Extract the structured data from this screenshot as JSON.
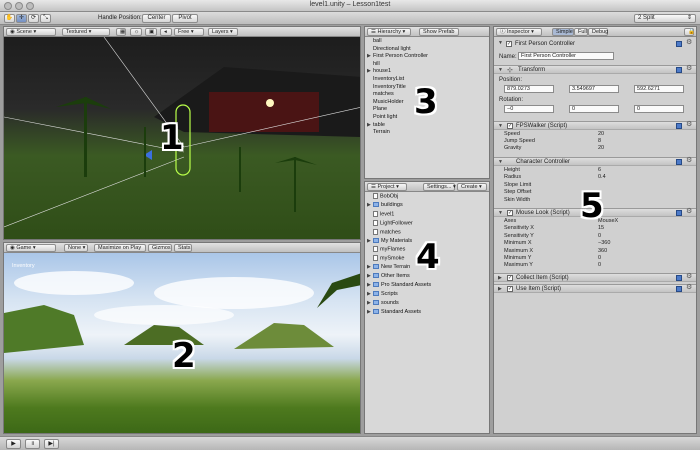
{
  "window": {
    "title": "level1.unity – Lesson1test"
  },
  "toolbar": {
    "handle_position_label": "Handle Position:",
    "center_label": "Center",
    "pivot_label": "Pivot",
    "layout_dropdown": "2 Split"
  },
  "scene": {
    "tab": "Scene",
    "render_mode": "Textured",
    "rgb_label": "RGB",
    "camera_mode": "Free",
    "layers_label": "Layers"
  },
  "game": {
    "tab": "Game",
    "aspect": "None",
    "maximize_on_play": "Maximize on Play",
    "gizmos": "Gizmos",
    "stats": "Stats",
    "overlay_text": "Inventory"
  },
  "hierarchy": {
    "tab": "Hierarchy",
    "show_prefab": "Show Prefab",
    "items": [
      {
        "label": "ball",
        "arrow": ""
      },
      {
        "label": "Directional light",
        "arrow": ""
      },
      {
        "label": "First Person Controller",
        "arrow": "▶"
      },
      {
        "label": "hill",
        "arrow": ""
      },
      {
        "label": "house1",
        "arrow": "▶"
      },
      {
        "label": "InventoryList",
        "arrow": ""
      },
      {
        "label": "InventoryTitle",
        "arrow": ""
      },
      {
        "label": "matches",
        "arrow": ""
      },
      {
        "label": "MusicHolder",
        "arrow": ""
      },
      {
        "label": "Plane",
        "arrow": ""
      },
      {
        "label": "Point light",
        "arrow": ""
      },
      {
        "label": "table",
        "arrow": "▶"
      },
      {
        "label": "Terrain",
        "arrow": ""
      }
    ]
  },
  "project": {
    "tab": "Project",
    "settings": "Settings...",
    "create": "Create",
    "items": [
      {
        "label": "BobObj",
        "arrow": "",
        "kind": "file"
      },
      {
        "label": "buildings",
        "arrow": "▶",
        "kind": "folder"
      },
      {
        "label": "level1",
        "arrow": "",
        "kind": "file"
      },
      {
        "label": "LightFollower",
        "arrow": "",
        "kind": "file"
      },
      {
        "label": "matches",
        "arrow": "",
        "kind": "file"
      },
      {
        "label": "My Materials",
        "arrow": "▶",
        "kind": "folder"
      },
      {
        "label": "myFlames",
        "arrow": "",
        "kind": "file"
      },
      {
        "label": "mySmoke",
        "arrow": "",
        "kind": "file"
      },
      {
        "label": "New Terrain",
        "arrow": "▶",
        "kind": "folder"
      },
      {
        "label": "Other Items",
        "arrow": "▶",
        "kind": "folder"
      },
      {
        "label": "Pro Standard Assets",
        "arrow": "▶",
        "kind": "folder"
      },
      {
        "label": "Scripts",
        "arrow": "▶",
        "kind": "folder"
      },
      {
        "label": "sounds",
        "arrow": "▶",
        "kind": "folder"
      },
      {
        "label": "Standard Assets",
        "arrow": "▶",
        "kind": "folder"
      }
    ]
  },
  "inspector": {
    "tab": "Inspector",
    "modes": [
      "Simple",
      "Full",
      "Debug"
    ],
    "object_name_header": "First Person Controller",
    "name_label": "Name:",
    "name_value": "First Person Controller",
    "transform": {
      "title": "Transform",
      "position_label": "Position:",
      "position": [
        "879.0273",
        "3.549697",
        "592.6271"
      ],
      "rotation_label": "Rotation:",
      "rotation": [
        "−0",
        "0",
        "0"
      ]
    },
    "fpswalker": {
      "title": "FPSWalker (Script)",
      "props": [
        {
          "name": "Speed",
          "value": "20"
        },
        {
          "name": "Jump Speed",
          "value": "8"
        },
        {
          "name": "Gravity",
          "value": "20"
        }
      ]
    },
    "character_controller": {
      "title": "Character Controller",
      "props": [
        {
          "name": "Height",
          "value": "6"
        },
        {
          "name": "Radius",
          "value": "0.4"
        },
        {
          "name": "Slope Limit",
          "value": ""
        },
        {
          "name": "Step Offset",
          "value": ""
        },
        {
          "name": "Skin Width",
          "value": ""
        }
      ]
    },
    "mouse_look": {
      "title": "Mouse Look (Script)",
      "props": [
        {
          "name": "Axes",
          "value": "MouseX"
        },
        {
          "name": "Sensitivity X",
          "value": "15"
        },
        {
          "name": "Sensitivity Y",
          "value": "0"
        },
        {
          "name": "Minimum X",
          "value": "−360"
        },
        {
          "name": "Maximum X",
          "value": "360"
        },
        {
          "name": "Minimum Y",
          "value": "0"
        },
        {
          "name": "Maximum Y",
          "value": "0"
        }
      ]
    },
    "collect_item": {
      "title": "Collect Item (Script)"
    },
    "use_item": {
      "title": "Use Item (Script)"
    }
  },
  "callouts": [
    "1",
    "2",
    "3",
    "4",
    "5"
  ],
  "playback": {
    "play": "▶",
    "pause": "॥",
    "step": "▶|"
  }
}
